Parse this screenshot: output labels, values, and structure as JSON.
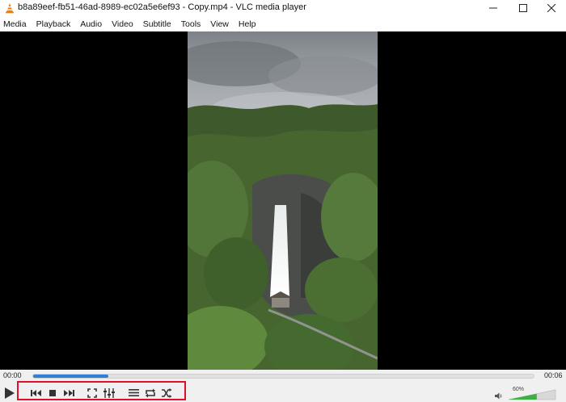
{
  "window": {
    "title": "b8a89eef-fb51-46ad-8989-ec02a5e6ef93 - Copy.mp4 - VLC media player",
    "icon": "vlc-cone-icon",
    "controls": [
      "minimize-icon",
      "maximize-icon",
      "close-icon"
    ]
  },
  "menu": {
    "items": [
      "Media",
      "Playback",
      "Audio",
      "Video",
      "Subtitle",
      "Tools",
      "View",
      "Help"
    ]
  },
  "player": {
    "elapsed": "00:00",
    "remaining": "00:06",
    "progress_fraction": 0.15,
    "volume_label": "60%",
    "volume_fraction": 0.6,
    "video_content": "waterfall-video-frame"
  },
  "controls": {
    "buttons": [
      "play-icon",
      "previous-icon",
      "stop-icon",
      "next-icon",
      "fullscreen-icon",
      "extended-settings-icon",
      "playlist-icon",
      "loop-icon",
      "shuffle-icon"
    ]
  },
  "colors": {
    "highlight_box": "#e0102a",
    "seek_fill": "#2f7fd4",
    "volume_fill": "#3cb043",
    "vlc_orange": "#f57c00"
  }
}
